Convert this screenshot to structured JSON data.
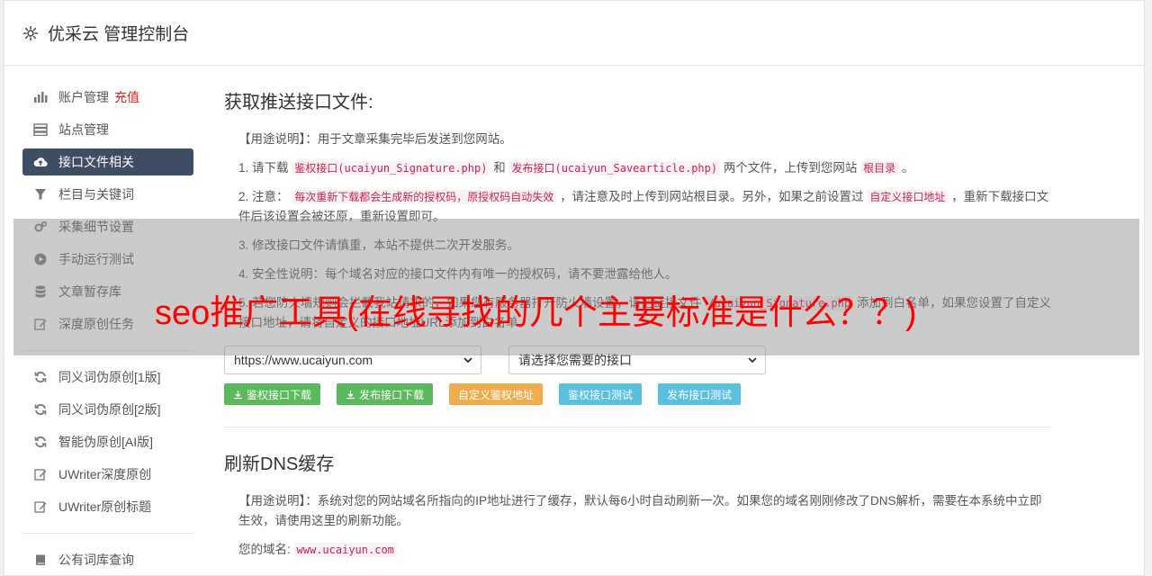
{
  "header": {
    "title": "优采云 管理控制台",
    "icon": "gear-icon"
  },
  "sidebar": {
    "items": [
      {
        "label": "账户管理",
        "extra": "充值",
        "icon": "bar-chart-icon"
      },
      {
        "label": "站点管理",
        "icon": "server-icon"
      },
      {
        "label": "接口文件相关",
        "icon": "cloud-upload-icon",
        "active": true
      },
      {
        "label": "栏目与关键词",
        "icon": "filter-icon"
      },
      {
        "label": "采集细节设置",
        "icon": "cogs-icon"
      },
      {
        "label": "手动运行测试",
        "icon": "play-circle-icon"
      },
      {
        "label": "文章暂存库",
        "icon": "database-icon"
      },
      {
        "label": "深度原创任务",
        "icon": "edit-icon"
      }
    ],
    "items2": [
      {
        "label": "同义词伪原创[1版]",
        "icon": "refresh-icon"
      },
      {
        "label": "同义词伪原创[2版]",
        "icon": "refresh-icon"
      },
      {
        "label": "智能伪原创[AI版]",
        "icon": "refresh-icon"
      },
      {
        "label": "UWriter深度原创",
        "icon": "edit-icon"
      },
      {
        "label": "UWriter原创标题",
        "icon": "edit-icon"
      }
    ],
    "items3": [
      {
        "label": "公有词库查询",
        "icon": "book-icon"
      }
    ]
  },
  "section1": {
    "title": "获取推送接口文件:",
    "usage": "【用途说明】：用于文章采集完毕后发送到您网站。",
    "step1": {
      "prefix": "1. 请下载",
      "code1": "鉴权接口(ucaiyun_Signature.php)",
      "mid": "和",
      "code2": "发布接口(ucaiyun_Savearticle.php)",
      "suffix": "两个文件，上传到您网站",
      "code3": "根目录",
      "end": "。"
    },
    "step2": {
      "prefix": "2. 注意：",
      "code1": "每次重新下载都会生成新的授权码，原授权码自动失效",
      "mid": "，请注意及时上传到网站根目录。另外，如果之前设置过",
      "code2": "自定义接口地址",
      "suffix": "，重新下载接口文件后该设置会被还原，重新设置即可。"
    },
    "step3": "3. 修改接口文件请慎重，本站不提供二次开发服务。",
    "step4": "4. 安全性说明：每个域名对应的接口文件内有唯一的授权码，请不要泄露给他人。",
    "step5": {
      "prefix": "5. 若您防火墙规则会拦截我站请求的，如果您有服务器打开防火墙设置，请把链接文件",
      "code1": "/ucaiyun_Signature.php",
      "suffix": "添加到白名单，如果您设置了自定义接口地址，请将自定义的接口地址URL添加到白名单。"
    },
    "site_select": "https://www.ucaiyun.com",
    "iface_select": "请选择您需要的接口",
    "buttons": {
      "b1": "鉴权接口下载",
      "b2": "发布接口下载",
      "b3": "自定义鉴权地址",
      "b4": "鉴权接口测试",
      "b5": "发布接口测试"
    }
  },
  "section2": {
    "title": "刷新DNS缓存",
    "usage": "【用途说明】：系统对您的网站域名所指向的IP地址进行了缓存，默认每6小时自动刷新一次。如果您的域名刚刚修改了DNS解析，需要在本系统中立即生效，请使用这里的刷新功能。",
    "domain_label": "您的域名:",
    "domain_value": "www.ucaiyun.com"
  },
  "overlay": {
    "text": "seo推广工具(在线寻找的几个主要标准是什么？？)"
  },
  "colors": {
    "active_nav": "#3e4d63",
    "green": "#5cb85c",
    "orange": "#f0ad4e",
    "blue": "#5bc0de",
    "overlay_text": "#ff0000"
  }
}
